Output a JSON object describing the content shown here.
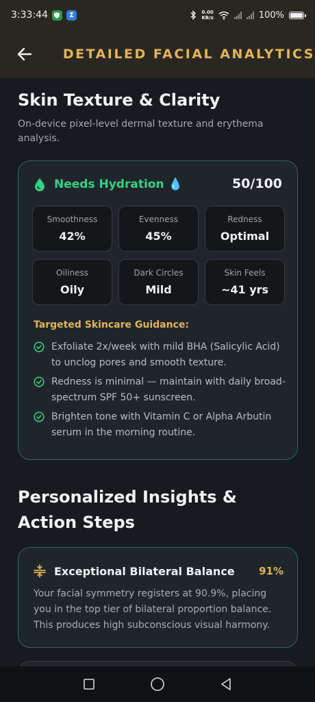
{
  "status_bar": {
    "time": "3:33:44",
    "net_speed_value": "0.00",
    "net_speed_unit": "KB/s",
    "battery": "100%"
  },
  "header": {
    "title": "DETAILED FACIAL ANALYTICS"
  },
  "skin_section": {
    "title": "Skin Texture & Clarity",
    "subtitle": "On-device pixel-level dermal texture and erythema analysis.",
    "card": {
      "status": "Needs Hydration 💧",
      "score": "50/100",
      "metrics": [
        {
          "label": "Smoothness",
          "value": "42%"
        },
        {
          "label": "Evenness",
          "value": "45%"
        },
        {
          "label": "Redness",
          "value": "Optimal"
        },
        {
          "label": "Oiliness",
          "value": "Oily"
        },
        {
          "label": "Dark Circles",
          "value": "Mild"
        },
        {
          "label": "Skin Feels",
          "value": "~41 yrs"
        }
      ],
      "guidance_title": "Targeted Skincare Guidance:",
      "guidance": [
        "Exfoliate 2x/week with mild BHA (Salicylic Acid) to unclog pores and smooth texture.",
        "Redness is minimal — maintain with daily broad-spectrum SPF 50+ sunscreen.",
        "Brighten tone with Vitamin C or Alpha Arbutin serum in the morning routine."
      ]
    }
  },
  "insights_section": {
    "title": "Personalized Insights & Action Steps",
    "cards": [
      {
        "title": "Exceptional Bilateral Balance",
        "percent": "91%",
        "body": "Your facial symmetry registers at 90.9%, placing you in the top tier of bilateral proportion balance. This produces high subconscious visual harmony."
      }
    ]
  },
  "icons": {
    "back": "arrow-left-icon",
    "status_drop": "water-drop-icon",
    "check": "check-circle-icon",
    "balance": "balance-icon",
    "nav_recents": "square-icon",
    "nav_home": "circle-icon",
    "nav_back": "triangle-back-icon"
  },
  "colors": {
    "accent_gold": "#e3b454",
    "status_green": "#2fd483",
    "card_border": "#2f6a53",
    "background": "#171a1f"
  }
}
